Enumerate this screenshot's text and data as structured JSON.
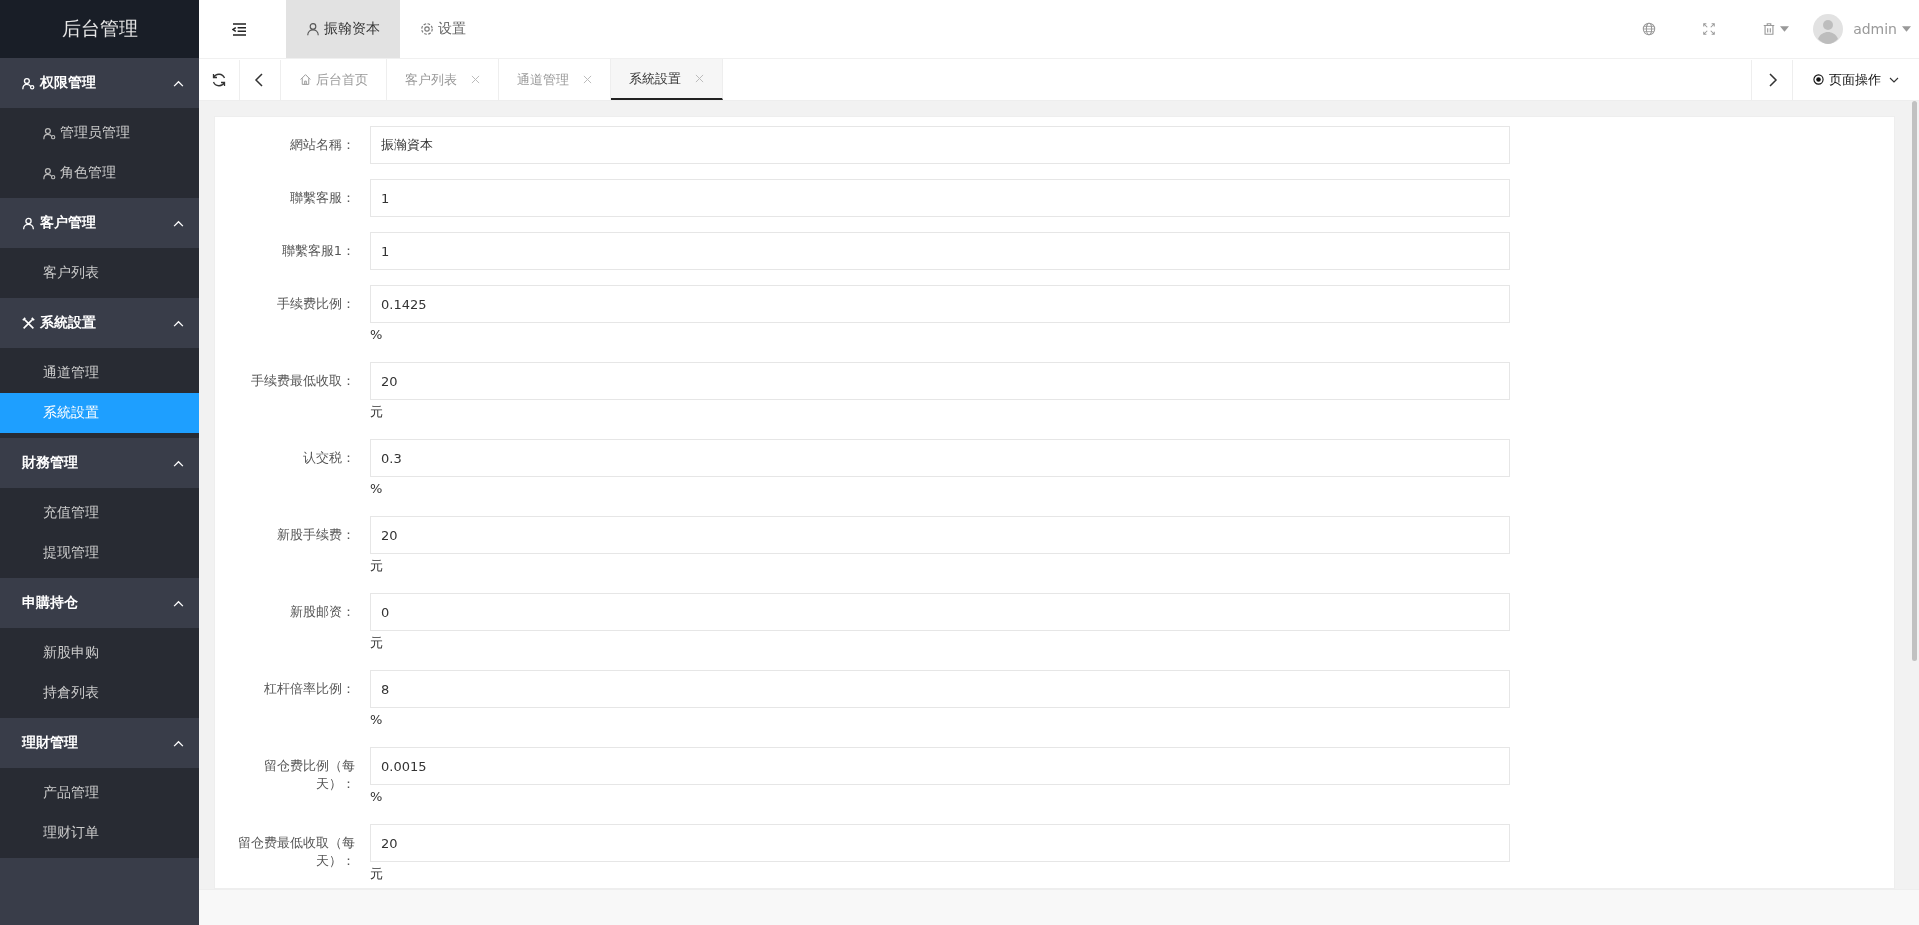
{
  "logo": "后台管理",
  "sidebar": [
    {
      "title": "权限管理",
      "expanded": true,
      "items": [
        {
          "label": "管理员管理",
          "selected": false
        },
        {
          "label": "角色管理",
          "selected": false
        }
      ]
    },
    {
      "title": "客户管理",
      "expanded": true,
      "items": [
        {
          "label": "客户列表",
          "selected": false
        }
      ]
    },
    {
      "title": "系統設置",
      "expanded": true,
      "items": [
        {
          "label": "通道管理",
          "selected": false
        },
        {
          "label": "系統設置",
          "selected": true
        }
      ]
    },
    {
      "title": "財務管理",
      "expanded": true,
      "items": [
        {
          "label": "充值管理",
          "selected": false
        },
        {
          "label": "提现管理",
          "selected": false
        }
      ]
    },
    {
      "title": "申購持仓",
      "expanded": true,
      "items": [
        {
          "label": "新股申购",
          "selected": false
        },
        {
          "label": "持倉列表",
          "selected": false
        }
      ]
    },
    {
      "title": "理財管理",
      "expanded": true,
      "items": [
        {
          "label": "产品管理",
          "selected": false
        },
        {
          "label": "理财订单",
          "selected": false
        }
      ]
    }
  ],
  "top_nav": [
    {
      "label": "振翰资本",
      "selected": true
    },
    {
      "label": "设置",
      "selected": false
    }
  ],
  "user": {
    "name": "admin"
  },
  "tabs": [
    {
      "label": "后台首页",
      "selected": false
    },
    {
      "label": "客户列表",
      "selected": false
    },
    {
      "label": "通道管理",
      "selected": false
    },
    {
      "label": "系統設置",
      "selected": true
    }
  ],
  "page_actions": "页面操作",
  "form": [
    {
      "label": "網站名稱：",
      "value": "振瀚資本"
    },
    {
      "label": "聯繫客服：",
      "value": "1"
    },
    {
      "label": "聯繫客服1：",
      "value": "1"
    },
    {
      "label": "手续费比例：",
      "value": "0.1425",
      "unit": "%"
    },
    {
      "label": "手续费最低收取：",
      "value": "20",
      "unit": "元"
    },
    {
      "label": "认交税：",
      "value": "0.3",
      "unit": "%"
    },
    {
      "label": "新股手续费：",
      "value": "20",
      "unit": "元"
    },
    {
      "label": "新股邮资：",
      "value": "0",
      "unit": "元"
    },
    {
      "label": "杠杆倍率比例：",
      "value": "8",
      "unit": "%"
    },
    {
      "label": "留仓费比例（每天）：",
      "value": "0.0015",
      "unit": "%"
    },
    {
      "label": "留仓费最低收取（每天）：",
      "value": "20",
      "unit": "元"
    }
  ]
}
